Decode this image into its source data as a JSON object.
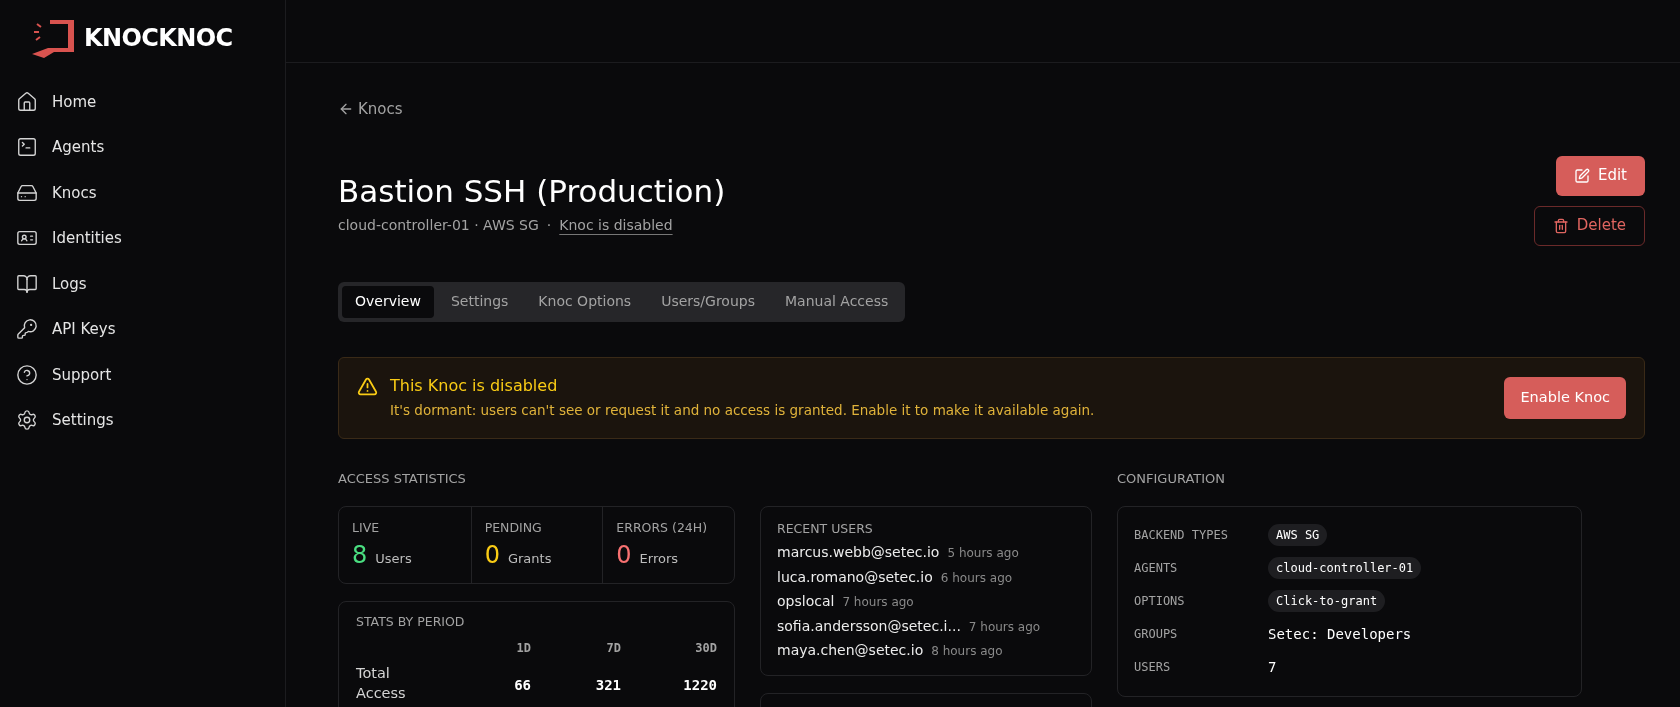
{
  "brand": {
    "name": "KNOCKNOC"
  },
  "sidebar": {
    "items": [
      {
        "label": "Home",
        "selected": false
      },
      {
        "label": "Agents",
        "selected": false
      },
      {
        "label": "Knocs",
        "selected": false
      },
      {
        "label": "Identities",
        "selected": false
      },
      {
        "label": "Logs",
        "selected": false
      },
      {
        "label": "API Keys",
        "selected": false
      },
      {
        "label": "Support",
        "selected": false
      },
      {
        "label": "Settings",
        "selected": false
      }
    ]
  },
  "back_link": "Knocs",
  "header": {
    "title": "Bastion SSH (Production)",
    "subtitle": "cloud-controller-01 · AWS SG",
    "separator": "·",
    "status_link": "Knoc is disabled"
  },
  "actions": [
    {
      "label": "Edit",
      "kind": "primary"
    },
    {
      "label": "Delete",
      "kind": "danger"
    }
  ],
  "tabs": [
    {
      "label": "Overview",
      "selected": true
    },
    {
      "label": "Settings",
      "selected": false
    },
    {
      "label": "Knoc Options",
      "selected": false
    },
    {
      "label": "Users/Groups",
      "selected": false
    },
    {
      "label": "Manual Access",
      "selected": false
    }
  ],
  "alert": {
    "title": "This Knoc is disabled",
    "message": "It's dormant: users can't see or request it and no access is granted. Enable it to make it available again.",
    "button": "Enable Knoc"
  },
  "access_statistics": {
    "heading": "ACCESS STATISTICS",
    "tiles": [
      {
        "label": "LIVE",
        "value": "8",
        "unit": "Users",
        "color": "#4ade80"
      },
      {
        "label": "PENDING",
        "value": "0",
        "unit": "Grants",
        "color": "#facc15"
      },
      {
        "label": "ERRORS (24H)",
        "value": "0",
        "unit": "Errors",
        "color": "#f87171"
      }
    ],
    "by_period": {
      "heading": "STATS BY PERIOD",
      "columns": [
        "1D",
        "7D",
        "30D"
      ],
      "rows": [
        {
          "label": "Total Access",
          "values": [
            "66",
            "321",
            "1220"
          ]
        }
      ]
    }
  },
  "recent_users": {
    "heading": "RECENT USERS",
    "users": [
      {
        "name": "marcus.webb@setec.io",
        "time": "5 hours ago"
      },
      {
        "name": "luca.romano@setec.io",
        "time": "6 hours ago"
      },
      {
        "name": "opslocal",
        "time": "7 hours ago"
      },
      {
        "name": "sofia.andersson@setec.i...",
        "time": "7 hours ago"
      },
      {
        "name": "maya.chen@setec.io",
        "time": "8 hours ago"
      }
    ]
  },
  "configuration": {
    "heading": "CONFIGURATION",
    "rows": [
      {
        "label": "BACKEND TYPES",
        "value": "AWS SG",
        "kind": "pill"
      },
      {
        "label": "AGENTS",
        "value": "cloud-controller-01",
        "kind": "pill"
      },
      {
        "label": "OPTIONS",
        "value": "Click-to-grant",
        "kind": "pill"
      },
      {
        "label": "GROUPS",
        "value": "Setec: Developers",
        "kind": "text"
      },
      {
        "label": "USERS",
        "value": "7",
        "kind": "text"
      }
    ]
  }
}
